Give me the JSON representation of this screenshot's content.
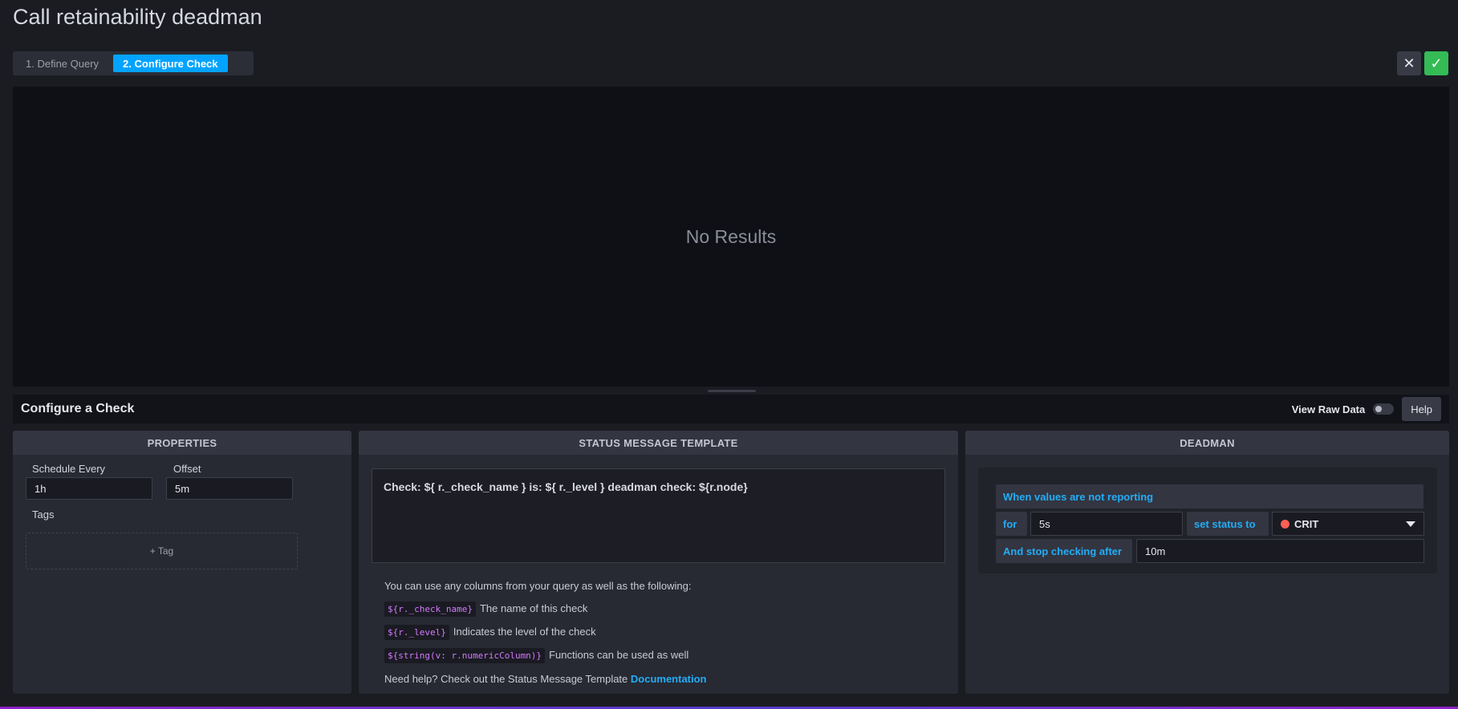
{
  "page": {
    "title": "Call retainability deadman"
  },
  "steps": [
    {
      "label": "1. Define Query",
      "active": false
    },
    {
      "label": "2. Configure Check",
      "active": true
    }
  ],
  "actions": {
    "cancel_icon": "close-icon",
    "confirm_icon": "check-icon",
    "cancel_glyph": "✕",
    "confirm_glyph": "✓"
  },
  "results": {
    "empty_text": "No Results"
  },
  "config": {
    "title": "Configure a Check",
    "raw_data_label": "View Raw Data",
    "raw_data_enabled": false,
    "help_label": "Help"
  },
  "properties": {
    "header": "PROPERTIES",
    "schedule_label": "Schedule Every",
    "schedule_value": "1h",
    "offset_label": "Offset",
    "offset_value": "5m",
    "tags_label": "Tags",
    "add_tag_label": "+ Tag"
  },
  "status_template": {
    "header": "STATUS MESSAGE TEMPLATE",
    "template": "Check: ${ r._check_name } is: ${ r._level } deadman check: ${r.node}",
    "intro": "You can use any columns from your query as well as the following:",
    "vars": [
      {
        "code": "${r._check_name}",
        "desc": "The name of this check"
      },
      {
        "code": "${r._level}",
        "desc": "Indicates the level of the check"
      },
      {
        "code": "${string(v: r.numericColumn)}",
        "desc": "Functions can be used as well"
      }
    ],
    "help_prefix": "Need help? Check out the Status Message Template ",
    "help_link": "Documentation"
  },
  "deadman": {
    "header": "DEADMAN",
    "when_label": "When values are not reporting",
    "for_label": "for",
    "for_value": "5s",
    "set_status_label": "set status to",
    "status_value": "CRIT",
    "stop_label": "And stop checking after",
    "stop_value": "10m"
  },
  "colors": {
    "accent": "#00a3ff",
    "confirm": "#34bb55",
    "crit": "#f95f53",
    "link": "#22adf6"
  }
}
